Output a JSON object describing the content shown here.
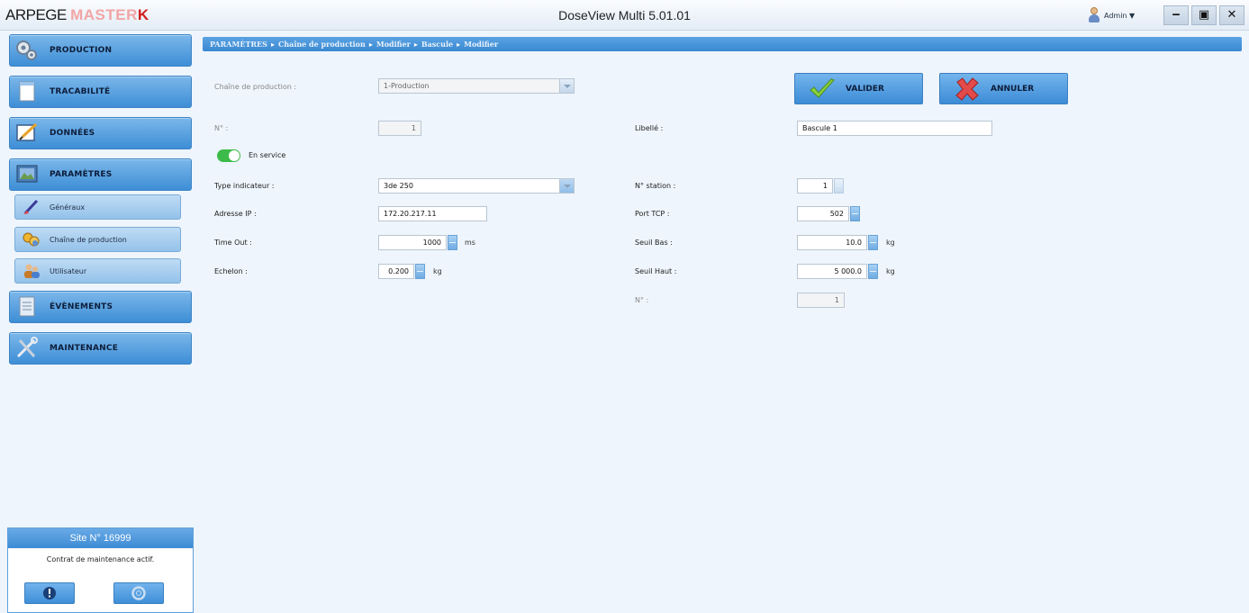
{
  "header": {
    "logo": {
      "part1": "ARPEGE ",
      "part2": "MASTER",
      "part3": "K"
    },
    "app_title": "DoseView Multi 5.01.01",
    "user": "Admin ▼",
    "window_buttons": {
      "minimize": "‒",
      "maximize": "▣",
      "close": "✕"
    }
  },
  "sidebar": {
    "nav": [
      {
        "label": "PRODUCTION",
        "icon": "production-icon"
      },
      {
        "label": "TRACABILITÉ",
        "icon": "document-icon"
      },
      {
        "label": "DONNÉES",
        "icon": "edit-icon"
      },
      {
        "label": "PARAMÈTRES",
        "icon": "settings-icon"
      },
      {
        "label": "ÉVÈNEMENTS",
        "icon": "events-icon"
      },
      {
        "label": "MAINTENANCE",
        "icon": "tools-icon"
      }
    ],
    "sub_items": [
      {
        "label": "Généraux",
        "icon": "brush-icon"
      },
      {
        "label": "Chaîne de production",
        "icon": "chain-icon"
      },
      {
        "label": "Utilisateur",
        "icon": "users-icon"
      }
    ],
    "site": {
      "title": "Site N° 16999",
      "text": "Contrat de maintenance actif."
    }
  },
  "breadcrumb": [
    "PARAMÈTRES",
    "Chaîne de production",
    "Modifier",
    "Bascule",
    "Modifier"
  ],
  "form": {
    "chain_label": "Chaîne de production :",
    "chain_value": "1-Production",
    "number_label": "N° :",
    "number_value": "1",
    "libelle_label": "Libellé :",
    "libelle_value": "Bascule 1",
    "toggle_label": "En service",
    "toggle_on": true,
    "type_label": "Type indicateur :",
    "type_value": "3de 250",
    "station_label": "N° station :",
    "station_value": "1",
    "ip_label": "Adresse IP :",
    "ip_value": "172.20.217.11",
    "port_label": "Port TCP :",
    "port_value": "502",
    "timeout_label": "Time Out :",
    "timeout_value": "1000",
    "timeout_unit": "ms",
    "seuil_bas_label": "Seuil Bas :",
    "seuil_bas_value": "10.0",
    "seuil_bas_unit": "kg",
    "echelon_label": "Echelon :",
    "echelon_value": "0.200",
    "echelon_unit": "kg",
    "seuil_haut_label": "Seuil Haut :",
    "seuil_haut_value": "5 000.0",
    "seuil_haut_unit": "kg",
    "n2_label": "N° :",
    "n2_value": "1"
  },
  "actions": {
    "validate": "VALIDER",
    "cancel": "ANNULER"
  },
  "colors": {
    "accent": "#3d8ed6",
    "toggle_on": "#3dbb4a",
    "cancel": "#d63a3a",
    "validate": "#7cc23a"
  }
}
